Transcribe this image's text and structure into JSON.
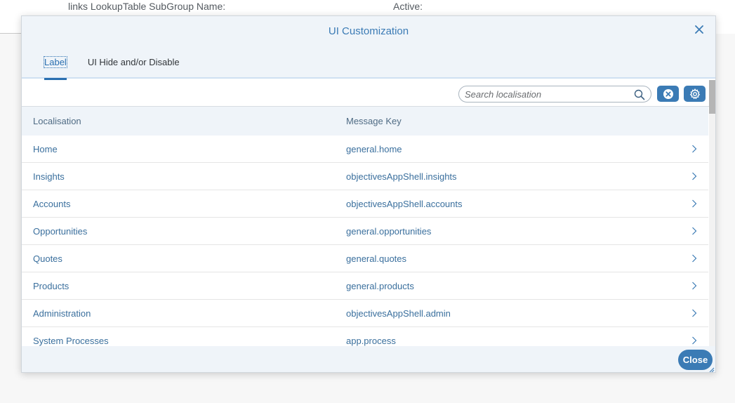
{
  "background": {
    "subgroup_label": "links LookupTable SubGroup Name:",
    "active_label": "Active:"
  },
  "dialog": {
    "title": "UI Customization",
    "tabs": [
      {
        "label": "Label",
        "active": true
      },
      {
        "label": "UI Hide and/or Disable",
        "active": false
      }
    ],
    "search": {
      "placeholder": "Search localisation",
      "value": ""
    },
    "table": {
      "columns": [
        "Localisation",
        "Message Key"
      ],
      "rows": [
        {
          "localisation": "Home",
          "message_key": "general.home"
        },
        {
          "localisation": "Insights",
          "message_key": "objectivesAppShell.insights"
        },
        {
          "localisation": "Accounts",
          "message_key": "objectivesAppShell.accounts"
        },
        {
          "localisation": "Opportunities",
          "message_key": "general.opportunities"
        },
        {
          "localisation": "Quotes",
          "message_key": "general.quotes"
        },
        {
          "localisation": "Products",
          "message_key": "general.products"
        },
        {
          "localisation": "Administration",
          "message_key": "objectivesAppShell.admin"
        },
        {
          "localisation": "System Processes",
          "message_key": "app.process"
        }
      ]
    },
    "footer": {
      "close_label": "Close"
    }
  },
  "icons": {
    "close": "close-icon",
    "search": "search-icon",
    "clear": "clear-icon",
    "settings": "gear-icon",
    "row_nav": "chevron-right-icon"
  },
  "colors": {
    "accent": "#3b7bb5",
    "header_bg": "#eff4f9",
    "link_text": "#3a6f9d"
  }
}
